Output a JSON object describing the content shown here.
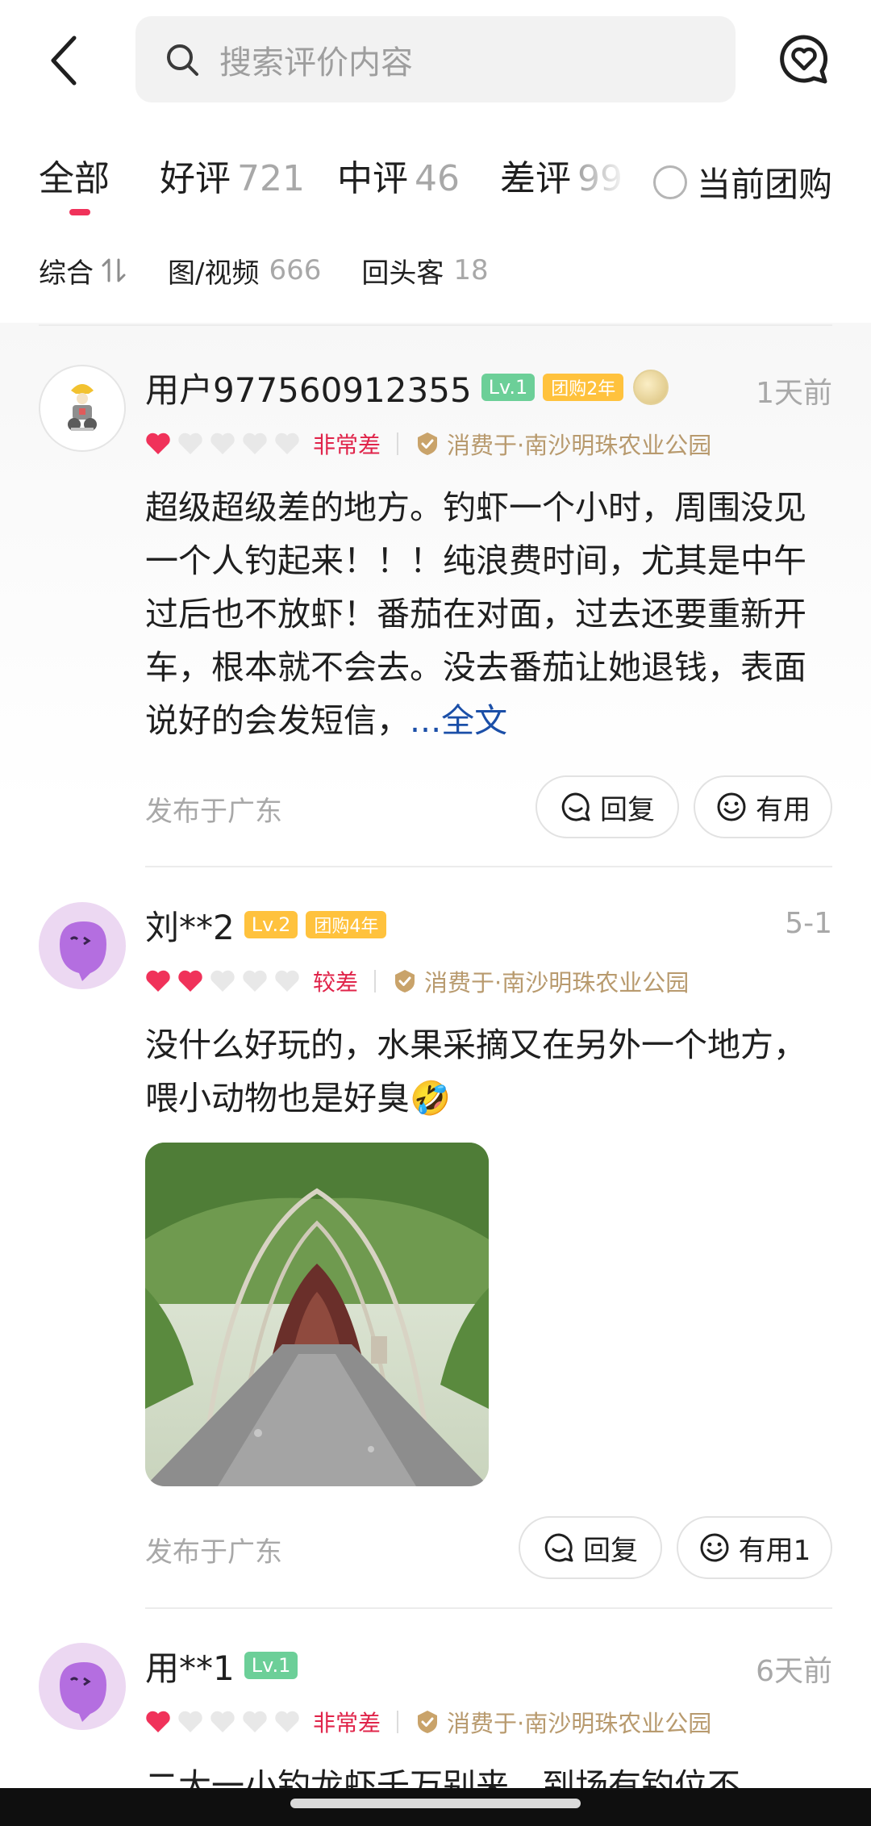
{
  "search": {
    "placeholder": "搜索评价内容"
  },
  "tabs": [
    {
      "label": "全部",
      "count": ""
    },
    {
      "label": "好评",
      "count": "721"
    },
    {
      "label": "中评",
      "count": "46"
    },
    {
      "label": "差评",
      "count": "99"
    }
  ],
  "current_group": {
    "label": "当前团购"
  },
  "filters": [
    {
      "label": "综合",
      "count": ""
    },
    {
      "label": "图/视频",
      "count": "666"
    },
    {
      "label": "回头客",
      "count": "18"
    }
  ],
  "colors": {
    "accent": "#f0325a",
    "link": "#1b4fa8",
    "level_green": "#6ccf98",
    "badge_gold": "#ffc23d",
    "rating_red": "#e0244a",
    "shop_tan": "#b89a6e"
  },
  "reviews": [
    {
      "username": "用户977560912355",
      "level": "Lv.1",
      "group_badge": "团购2年",
      "time": "1天前",
      "rating": 1,
      "rating_label": "非常差",
      "shop": "消费于·南沙明珠农业公园",
      "content": "超级超级差的地方。钓虾一个小时，周围没见一个人钓起来！！！纯浪费时间，尤其是中午过后也不放虾！番茄在对面，过去还要重新开车，根本就不会去。没去番茄让她退钱，表面说好的会发短信，",
      "more": "...全文",
      "published": "发布于广东",
      "reply_label": "回复",
      "useful_label": "有用"
    },
    {
      "username": "刘**2",
      "level": "Lv.2",
      "group_badge": "团购4年",
      "time": "5-1",
      "rating": 2,
      "rating_label": "较差",
      "shop": "消费于·南沙明珠农业公园",
      "content": "没什么好玩的，水果采摘又在另外一个地方，喂小动物也是好臭🤣",
      "published": "发布于广东",
      "reply_label": "回复",
      "useful_label": "有用1"
    },
    {
      "username": "用**1",
      "level": "Lv.1",
      "time": "6天前",
      "rating": 1,
      "rating_label": "非常差",
      "shop": "消费于·南沙明珠农业公园",
      "content": "二大一小钓龙虾千万别来，到场有钓位不"
    }
  ]
}
